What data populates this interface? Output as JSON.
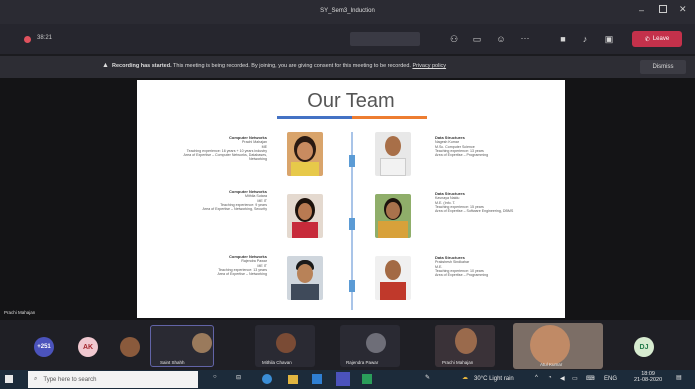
{
  "window": {
    "title": "SY_Sem3_Induction"
  },
  "toolbar": {
    "timer": "38:21",
    "leave_label": "Leave"
  },
  "banner": {
    "headline": "Recording has started.",
    "message": "This meeting is being recorded. By joining, you are giving consent for this meeting to be recorded.",
    "link": "Privacy policy",
    "dismiss": "Dismiss"
  },
  "slide": {
    "title": "Our Team",
    "left_members": [
      {
        "subject": "Computer Networks",
        "name": "Prachi Mahajan",
        "details": [
          "ME",
          "Teaching experience: 16 years + 10 years industry",
          "Area of Expertise – Computer Networks, Databases,",
          "Networking"
        ]
      },
      {
        "subject": "Computer Networks",
        "name": "Mithila Sutara",
        "details": [
          "ME IT",
          "Teaching experience: 9 years",
          "Area of Expertise – Networking, Security"
        ]
      },
      {
        "subject": "Computer Networks",
        "name": "Rajendra Pawar",
        "details": [
          "ME IT",
          "Teaching experience: 13 years",
          "Area of Expertise – Networking"
        ]
      }
    ],
    "right_members": [
      {
        "subject": "Data Structures",
        "name": "Nagesh Kumar",
        "details": [
          "M.Sc. Computer Science",
          "Teaching experience: 13 years",
          "Area of Expertise – Programming"
        ]
      },
      {
        "subject": "Data Structures",
        "name": "Kavnaya Naidu",
        "details": [
          "M.E. (Info. T.",
          "Teaching experience: 15 years",
          "Area of Expertise – Software Engineering, DBMS"
        ]
      },
      {
        "subject": "Data Structures",
        "name": "Prakshesh Sindkahar",
        "details": [
          "M.E.",
          "Teaching experience: 10 years",
          "Area of Expertise – Programming"
        ]
      }
    ]
  },
  "stage": {
    "presenter_label": "Prachi Mahajan"
  },
  "participants": {
    "overflow_count": "+251",
    "tiles": [
      {
        "initials": "AK"
      },
      {
        "name": ""
      },
      {
        "name": "Saint Shahh"
      },
      {
        "name": "Mithila Chavan"
      },
      {
        "name": "Rajendra Pawar"
      },
      {
        "name": "Prachi Mahajan"
      },
      {
        "name": "Atul Kumar"
      },
      {
        "initials": "DJ"
      }
    ]
  },
  "taskbar": {
    "search_placeholder": "Type here to search",
    "weather": "30°C Light rain",
    "language": "ENG",
    "time": "18:09",
    "date": "21-08-2020"
  },
  "colors": {
    "leave": "#c4314b",
    "accent_blue": "#4472c4",
    "accent_orange": "#ed7d31",
    "taskbar": "#1c2b3a"
  }
}
